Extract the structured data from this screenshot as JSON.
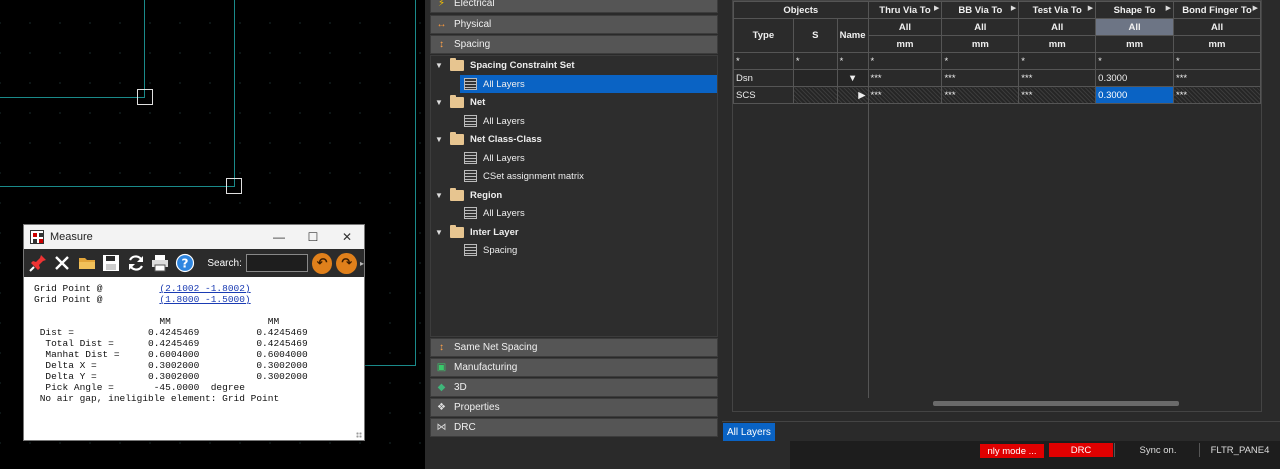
{
  "measure": {
    "title": "Measure",
    "search_label": "Search:",
    "search_value": "",
    "output": {
      "p1_label": "Grid Point @          ",
      "p1_link": "(2.1002 -1.8002)",
      "p2_label": "Grid Point @          ",
      "p2_link": "(1.8000 -1.5000)",
      "block": "\n\n                      MM                 MM\n Dist =             0.4245469          0.4245469\n  Total Dist =      0.4245469          0.4245469\n  Manhat Dist =     0.6004000          0.6004000\n  Delta X =         0.3002000          0.3002000\n  Delta Y =         0.3002000          0.3002000\n  Pick Angle =       -45.0000  degree\n No air gap, ineligible element: Grid Point"
    }
  },
  "worksheet_sections": {
    "electrical": "Electrical",
    "physical": "Physical",
    "spacing": "Spacing",
    "same_net_spacing": "Same Net Spacing",
    "manufacturing": "Manufacturing",
    "three_d": "3D",
    "properties": "Properties",
    "drc": "DRC"
  },
  "tree": {
    "scs": "Spacing Constraint Set",
    "scs_all": "All Layers",
    "net": "Net",
    "net_all": "All Layers",
    "ncc": "Net Class-Class",
    "ncc_all": "All Layers",
    "ncc_matrix": "CSet assignment matrix",
    "region": "Region",
    "region_all": "All Layers",
    "inter": "Inter Layer",
    "inter_spacing": "Spacing"
  },
  "grid": {
    "objects": "Objects",
    "type": "Type",
    "s": "S",
    "name": "Name",
    "columns": [
      "Thru Via To",
      "BB Via To",
      "Test Via To",
      "Shape To",
      "Bond Finger To"
    ],
    "all": "All",
    "unit": "mm",
    "filter": "*",
    "rows": [
      {
        "type": "Dsn",
        "values": [
          "***",
          "***",
          "***",
          "0.3000",
          "***"
        ]
      },
      {
        "type": "SCS",
        "values": [
          "***",
          "***",
          "***",
          "0.3000",
          "***"
        ]
      }
    ]
  },
  "tab_all_layers": "All Layers",
  "status": {
    "mode": "nly mode",
    "mode_more": "...",
    "drc": "DRC",
    "sync": "Sync on.",
    "pane": "FLTR_PANE4"
  },
  "colors": {
    "selection_blue": "#0a63c4",
    "status_red": "#e00000",
    "board_outline": "#1a8a8a"
  }
}
